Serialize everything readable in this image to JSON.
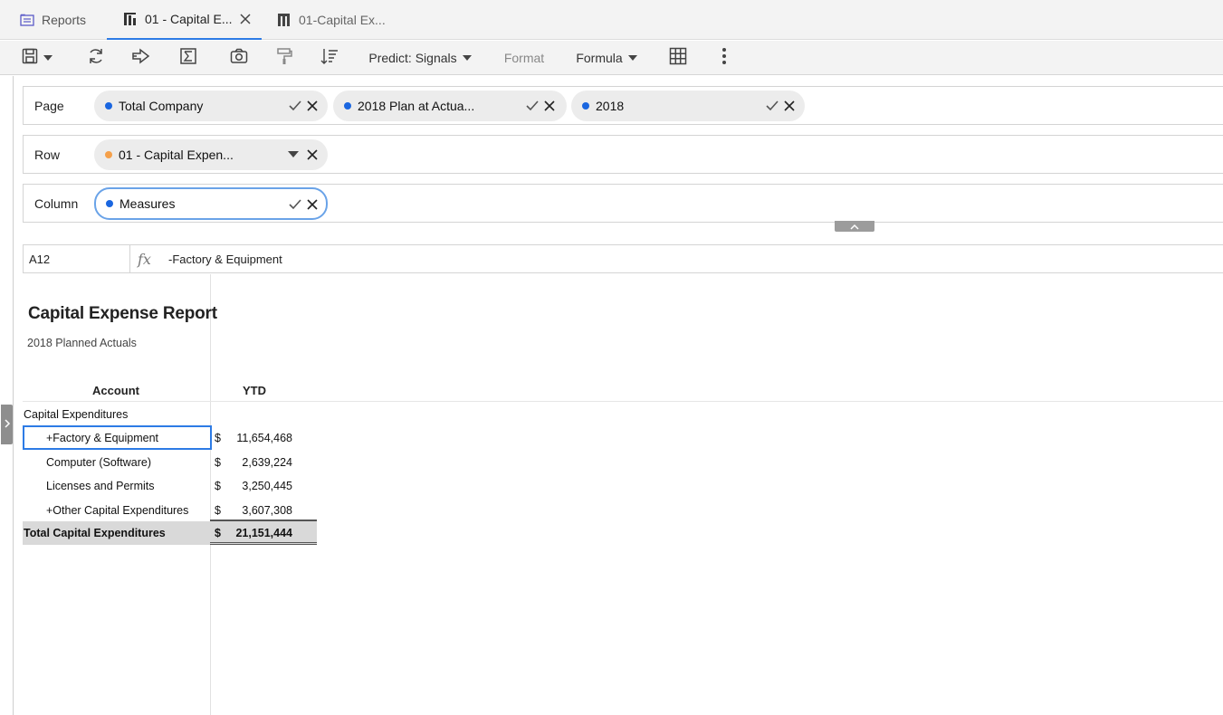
{
  "tabs": {
    "reports_label": "Reports",
    "active_label": "01 - Capital E...",
    "second_label": "01-Capital Ex..."
  },
  "toolbar": {
    "save_icon": "save-icon",
    "predict_label": "Predict: Signals",
    "format_label": "Format",
    "formula_label": "Formula"
  },
  "pov": {
    "page_label": "Page",
    "row_label": "Row",
    "column_label": "Column",
    "page_chips": [
      {
        "text": "Total Company",
        "color": "#1a66e0"
      },
      {
        "text": "2018 Plan at Actua...",
        "color": "#1a66e0"
      },
      {
        "text": "2018",
        "color": "#1a66e0"
      }
    ],
    "row_chip": {
      "text": "01 - Capital Expen...",
      "color": "#f5a04a"
    },
    "column_chip": {
      "text": "Measures",
      "color": "#1a66e0"
    }
  },
  "formula_bar": {
    "cell_ref": "A12",
    "fx": "fx",
    "content": "-Factory & Equipment"
  },
  "report": {
    "title": "Capital Expense Report",
    "subtitle": "2018 Planned Actuals",
    "col_account": "Account",
    "col_ytd": "YTD",
    "group_label": "Capital Expenditures",
    "rows": [
      {
        "label": "+Factory & Equipment",
        "currency": "$",
        "value": "11,654,468"
      },
      {
        "label": "Computer (Software)",
        "currency": "$",
        "value": "2,639,224"
      },
      {
        "label": "Licenses and Permits",
        "currency": "$",
        "value": "3,250,445"
      },
      {
        "label": "+Other Capital Expenditures",
        "currency": "$",
        "value": "3,607,308"
      }
    ],
    "total": {
      "label": "Total Capital Expenditures",
      "currency": "$",
      "value": "21,151,444"
    }
  }
}
